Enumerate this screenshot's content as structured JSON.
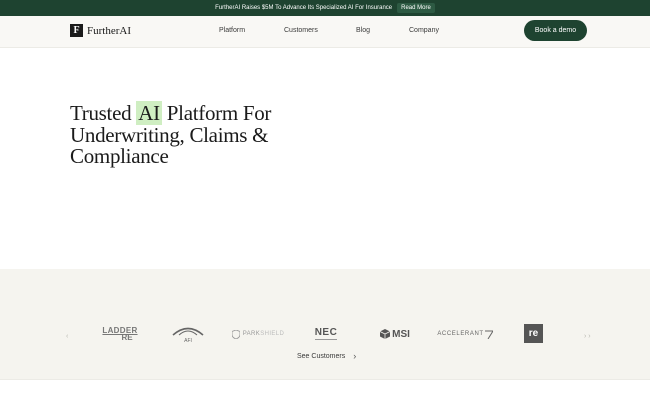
{
  "announcement": {
    "text": "FurtherAI Raises $5M To Advance Its Specialized AI For Insurance",
    "link": "Read More"
  },
  "brand": {
    "mark": "F",
    "name": "FurtherAI"
  },
  "nav": {
    "items": [
      "Platform",
      "Customers",
      "Blog",
      "Company"
    ],
    "cta": "Book a demo"
  },
  "hero": {
    "line1_pre": "Trusted ",
    "highlight": "AI",
    "line1_post": " Platform For",
    "line2": "Underwriting, Claims &",
    "line3": "Compliance"
  },
  "customers": {
    "logos": [
      {
        "name": "ladder-re",
        "line1": "LADDER",
        "line2": "RE"
      },
      {
        "name": "afi",
        "label": "AFI"
      },
      {
        "name": "parkshield",
        "pre": "PARK",
        "post": "SHIELD"
      },
      {
        "name": "nec",
        "label": "NEC"
      },
      {
        "name": "msi",
        "label": "MSI"
      },
      {
        "name": "accelerant",
        "label": "ACCELERANT"
      },
      {
        "name": "re",
        "label": "re"
      }
    ],
    "see_all": "See Customers",
    "arrow_left": "‹",
    "arrow_right": "› ›",
    "chevron": "›"
  },
  "colors": {
    "brand_green": "#1e4330",
    "highlight": "#cfeec2",
    "section_bg": "#f5f4ef"
  }
}
